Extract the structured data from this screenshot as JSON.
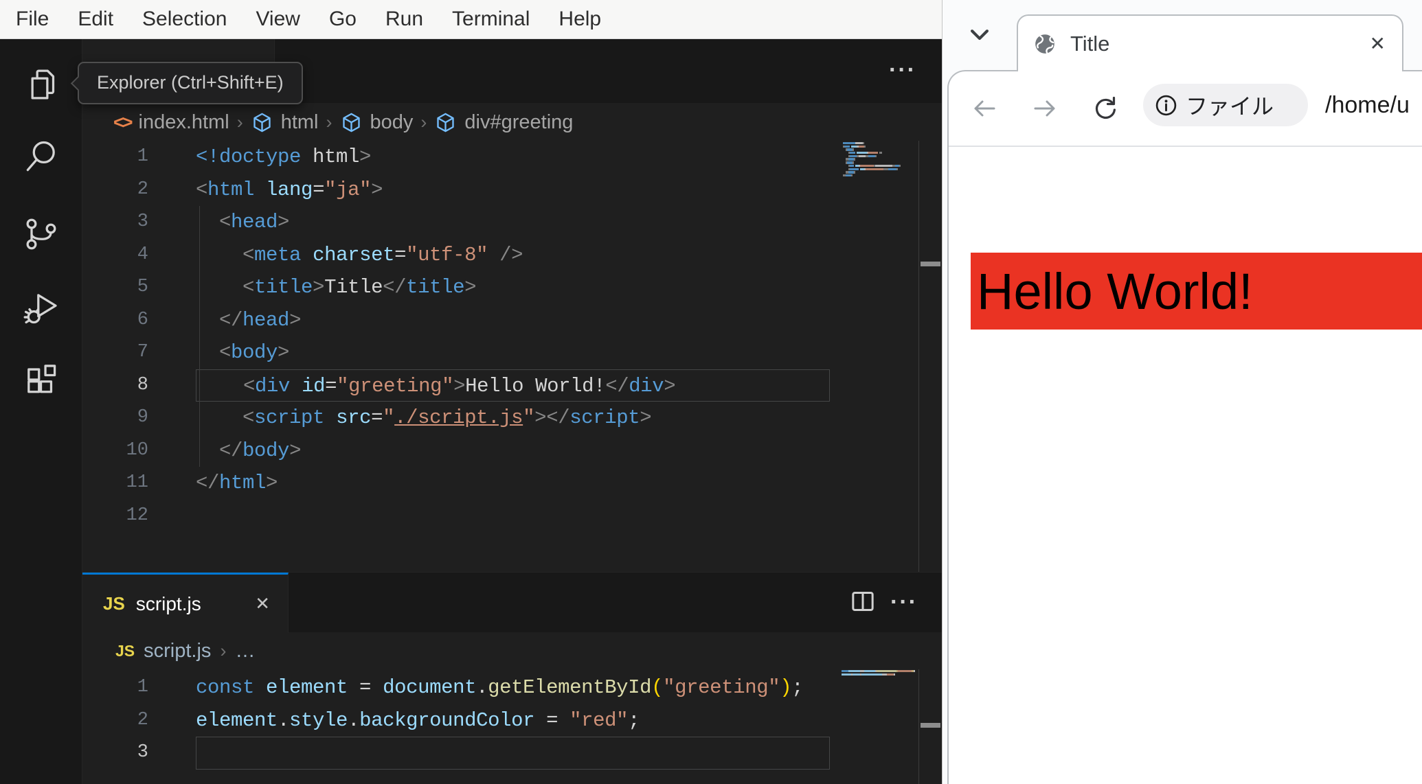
{
  "vscode": {
    "menu": {
      "items": [
        "File",
        "Edit",
        "Selection",
        "View",
        "Go",
        "Run",
        "Terminal",
        "Help"
      ]
    },
    "activity_bar": {
      "tooltip": "Explorer (Ctrl+Shift+E)",
      "icons": [
        "explorer-icon",
        "search-icon",
        "source-control-icon",
        "run-and-debug-icon",
        "extensions-icon"
      ]
    },
    "editor_actions": {
      "more": "···"
    },
    "html_breadcrumb": {
      "file_icon": "<>",
      "file": "index.html",
      "separator": "›",
      "segments": [
        "html",
        "body",
        "div#greeting"
      ]
    },
    "html_editor": {
      "current_line": 8,
      "lines": [
        [
          [
            "t",
            "<!doctype"
          ],
          [
            "x",
            " html"
          ],
          [
            "p",
            ">"
          ]
        ],
        [
          [
            "p",
            "<"
          ],
          [
            "t",
            "html"
          ],
          [
            "x",
            " "
          ],
          [
            "a",
            "lang"
          ],
          [
            "x",
            "="
          ],
          [
            "s",
            "\"ja\""
          ],
          [
            "p",
            ">"
          ]
        ],
        [
          [
            "x",
            "  "
          ],
          [
            "p",
            "<"
          ],
          [
            "t",
            "head"
          ],
          [
            "p",
            ">"
          ]
        ],
        [
          [
            "x",
            "    "
          ],
          [
            "p",
            "<"
          ],
          [
            "t",
            "meta"
          ],
          [
            "x",
            " "
          ],
          [
            "a",
            "charset"
          ],
          [
            "x",
            "="
          ],
          [
            "s",
            "\"utf-8\""
          ],
          [
            "x",
            " "
          ],
          [
            "p",
            "/>"
          ]
        ],
        [
          [
            "x",
            "    "
          ],
          [
            "p",
            "<"
          ],
          [
            "t",
            "title"
          ],
          [
            "p",
            ">"
          ],
          [
            "x",
            "Title"
          ],
          [
            "p",
            "<"
          ],
          [
            "p",
            "/"
          ],
          [
            "t",
            "title"
          ],
          [
            "p",
            ">"
          ]
        ],
        [
          [
            "x",
            "  "
          ],
          [
            "p",
            "<"
          ],
          [
            "p",
            "/"
          ],
          [
            "t",
            "head"
          ],
          [
            "p",
            ">"
          ]
        ],
        [
          [
            "x",
            "  "
          ],
          [
            "p",
            "<"
          ],
          [
            "t",
            "body"
          ],
          [
            "p",
            ">"
          ]
        ],
        [
          [
            "x",
            "    "
          ],
          [
            "p",
            "<"
          ],
          [
            "t",
            "div"
          ],
          [
            "x",
            " "
          ],
          [
            "a",
            "id"
          ],
          [
            "x",
            "="
          ],
          [
            "s",
            "\"greeting\""
          ],
          [
            "p",
            ">"
          ],
          [
            "x",
            "Hello World!"
          ],
          [
            "p",
            "<"
          ],
          [
            "p",
            "/"
          ],
          [
            "t",
            "div"
          ],
          [
            "p",
            ">"
          ]
        ],
        [
          [
            "x",
            "    "
          ],
          [
            "p",
            "<"
          ],
          [
            "t",
            "script"
          ],
          [
            "x",
            " "
          ],
          [
            "a",
            "src"
          ],
          [
            "x",
            "="
          ],
          [
            "s",
            "\""
          ],
          [
            "l",
            "./script.js"
          ],
          [
            "s",
            "\""
          ],
          [
            "p",
            ">"
          ],
          [
            "p",
            "<"
          ],
          [
            "p",
            "/"
          ],
          [
            "t",
            "script"
          ],
          [
            "p",
            ">"
          ]
        ],
        [
          [
            "x",
            "  "
          ],
          [
            "p",
            "<"
          ],
          [
            "p",
            "/"
          ],
          [
            "t",
            "body"
          ],
          [
            "p",
            ">"
          ]
        ],
        [
          [
            "p",
            "<"
          ],
          [
            "p",
            "/"
          ],
          [
            "t",
            "html"
          ],
          [
            "p",
            ">"
          ]
        ],
        []
      ]
    },
    "panel_tab": {
      "badge": "JS",
      "label": "script.js",
      "close": "✕"
    },
    "js_breadcrumb": {
      "badge": "JS",
      "file": "script.js",
      "separator": "›",
      "more": "…"
    },
    "js_editor": {
      "current_line": 3,
      "lines": [
        [
          [
            "k",
            "const"
          ],
          [
            "v",
            " element"
          ],
          [
            "x",
            " = "
          ],
          [
            "v",
            "document"
          ],
          [
            "x",
            "."
          ],
          [
            "f",
            "getElementById"
          ],
          [
            "b",
            "("
          ],
          [
            "s",
            "\"greeting\""
          ],
          [
            "b",
            ")"
          ],
          [
            "x",
            ";"
          ]
        ],
        [
          [
            "v",
            "element"
          ],
          [
            "x",
            "."
          ],
          [
            "v",
            "style"
          ],
          [
            "x",
            "."
          ],
          [
            "v",
            "backgroundColor"
          ],
          [
            "x",
            " = "
          ],
          [
            "s",
            "\"red\""
          ],
          [
            "x",
            ";"
          ]
        ],
        []
      ]
    },
    "colors": {
      "accent": "#0078d4",
      "js_badge": "#e8d44d",
      "editor_bg": "#1f1f1f",
      "activity_bg": "#181818"
    }
  },
  "browser": {
    "tab": {
      "title": "Title",
      "close": "✕",
      "icon": "globe-icon"
    },
    "toolbar": {
      "chip_label": "ファイル",
      "url": "/home/u"
    },
    "page": {
      "heading": "Hello World!",
      "heading_bg": "#ea3323"
    }
  }
}
